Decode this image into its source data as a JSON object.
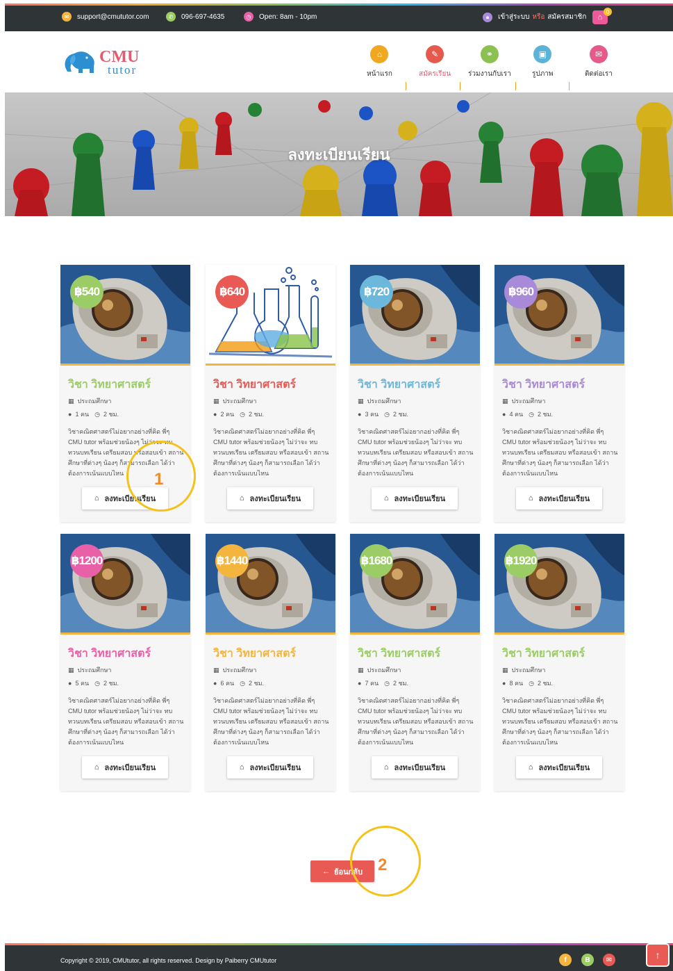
{
  "topbar": {
    "email": "support@cmututor.com",
    "phone": "096-697-4635",
    "hours": "Open: 8am - 10pm",
    "login": "เข้าสู่ระบบ",
    "or": "หรือ",
    "signup": "สมัครสมาชิก",
    "cart_count": "0",
    "icons": [
      "envelope-icon",
      "phone-icon",
      "clock-icon",
      "lock-icon",
      "basket-icon"
    ]
  },
  "logo": {
    "cmu": "CMU",
    "tutor": "tutor"
  },
  "nav": {
    "items": [
      {
        "label": "หน้าแรก",
        "icon": "home-icon",
        "color": "#f0a820"
      },
      {
        "label": "สมัครเรียน",
        "icon": "pencil-icon",
        "color": "#e65a4e"
      },
      {
        "label": "ร่วมงานกับเรา",
        "icon": "handshake-icon",
        "color": "#8cc152"
      },
      {
        "label": "รูปภาพ",
        "icon": "image-icon",
        "color": "#5db3d6"
      },
      {
        "label": "ติดต่อเรา",
        "icon": "envelope-icon",
        "color": "#e45a8a"
      }
    ]
  },
  "banner": {
    "title": "ลงทะเบียนเรียน"
  },
  "cards": [
    {
      "price": "฿540",
      "price_color": "#9ccc65",
      "title": "วิชา วิทยาศาสตร์",
      "title_color": "#9ccc65",
      "level": "ประถมศึกษา",
      "people": "1 คน",
      "hours": "2 ชม.",
      "image": "astronaut"
    },
    {
      "price": "฿640",
      "price_color": "#ea5a55",
      "title": "วิชา วิทยาศาสตร์",
      "title_color": "#ea5a55",
      "level": "ประถมศึกษา",
      "people": "2 คน",
      "hours": "2 ชม.",
      "image": "lab"
    },
    {
      "price": "฿720",
      "price_color": "#6cb8dc",
      "title": "วิชา วิทยาศาสตร์",
      "title_color": "#6cb8dc",
      "level": "ประถมศึกษา",
      "people": "3 คน",
      "hours": "2 ชม.",
      "image": "astronaut"
    },
    {
      "price": "฿960",
      "price_color": "#a98ad8",
      "title": "วิชา วิทยาศาสตร์",
      "title_color": "#a98ad8",
      "level": "ประถมศึกษา",
      "people": "4 คน",
      "hours": "2 ชม.",
      "image": "astronaut"
    },
    {
      "price": "฿1200",
      "price_color": "#e760a8",
      "title": "วิชา วิทยาศาสตร์",
      "title_color": "#e760a8",
      "level": "ประถมศึกษา",
      "people": "5 คน",
      "hours": "2 ชม.",
      "image": "astronaut"
    },
    {
      "price": "฿1440",
      "price_color": "#f4b53f",
      "title": "วิชา วิทยาศาสตร์",
      "title_color": "#f4b53f",
      "level": "ประถมศึกษา",
      "people": "6 คน",
      "hours": "2 ชม.",
      "image": "astronaut"
    },
    {
      "price": "฿1680",
      "price_color": "#9ccc65",
      "title": "วิชา วิทยาศาสตร์",
      "title_color": "#9ccc65",
      "level": "ประถมศึกษา",
      "people": "7 คน",
      "hours": "2 ชม.",
      "image": "astronaut"
    },
    {
      "price": "฿1920",
      "price_color": "#9ccc65",
      "title": "วิชา วิทยาศาสตร์",
      "title_color": "#9ccc65",
      "level": "ประถมศึกษา",
      "people": "8 คน",
      "hours": "2 ชม.",
      "image": "astronaut"
    }
  ],
  "card_desc": "วิชาคณิตศาสตร์ไม่อยากอย่างที่คิด พี่ๆ CMU tutor พร้อมช่วยน้องๆ ไม่ว่าจะ ทบ ทวนบทเรียน เตรียมสอบ หรือสอบเข้า สถานศึกษาที่ต่างๆ น้องๆ ก็สามารถเลือก ได้ว่าต้องการเน้นแบบไหน",
  "register_label": "ลงทะเบียนเรียน",
  "back_label": "ย้อนกลับ",
  "annotations": [
    "1",
    "2"
  ],
  "footer": {
    "copyright": "Copyright © 2019, CMUtutor, all rights reserved. Design by Paiberry CMUtutor",
    "social": [
      {
        "icon": "facebook-icon",
        "glyph": "f",
        "color": "#f4b53f"
      },
      {
        "icon": "blogger-icon",
        "glyph": "B",
        "color": "#9ccc65"
      },
      {
        "icon": "mail-icon",
        "glyph": "✉",
        "color": "#ea5a55"
      }
    ],
    "totop_icon": "arrow-up-icon"
  }
}
